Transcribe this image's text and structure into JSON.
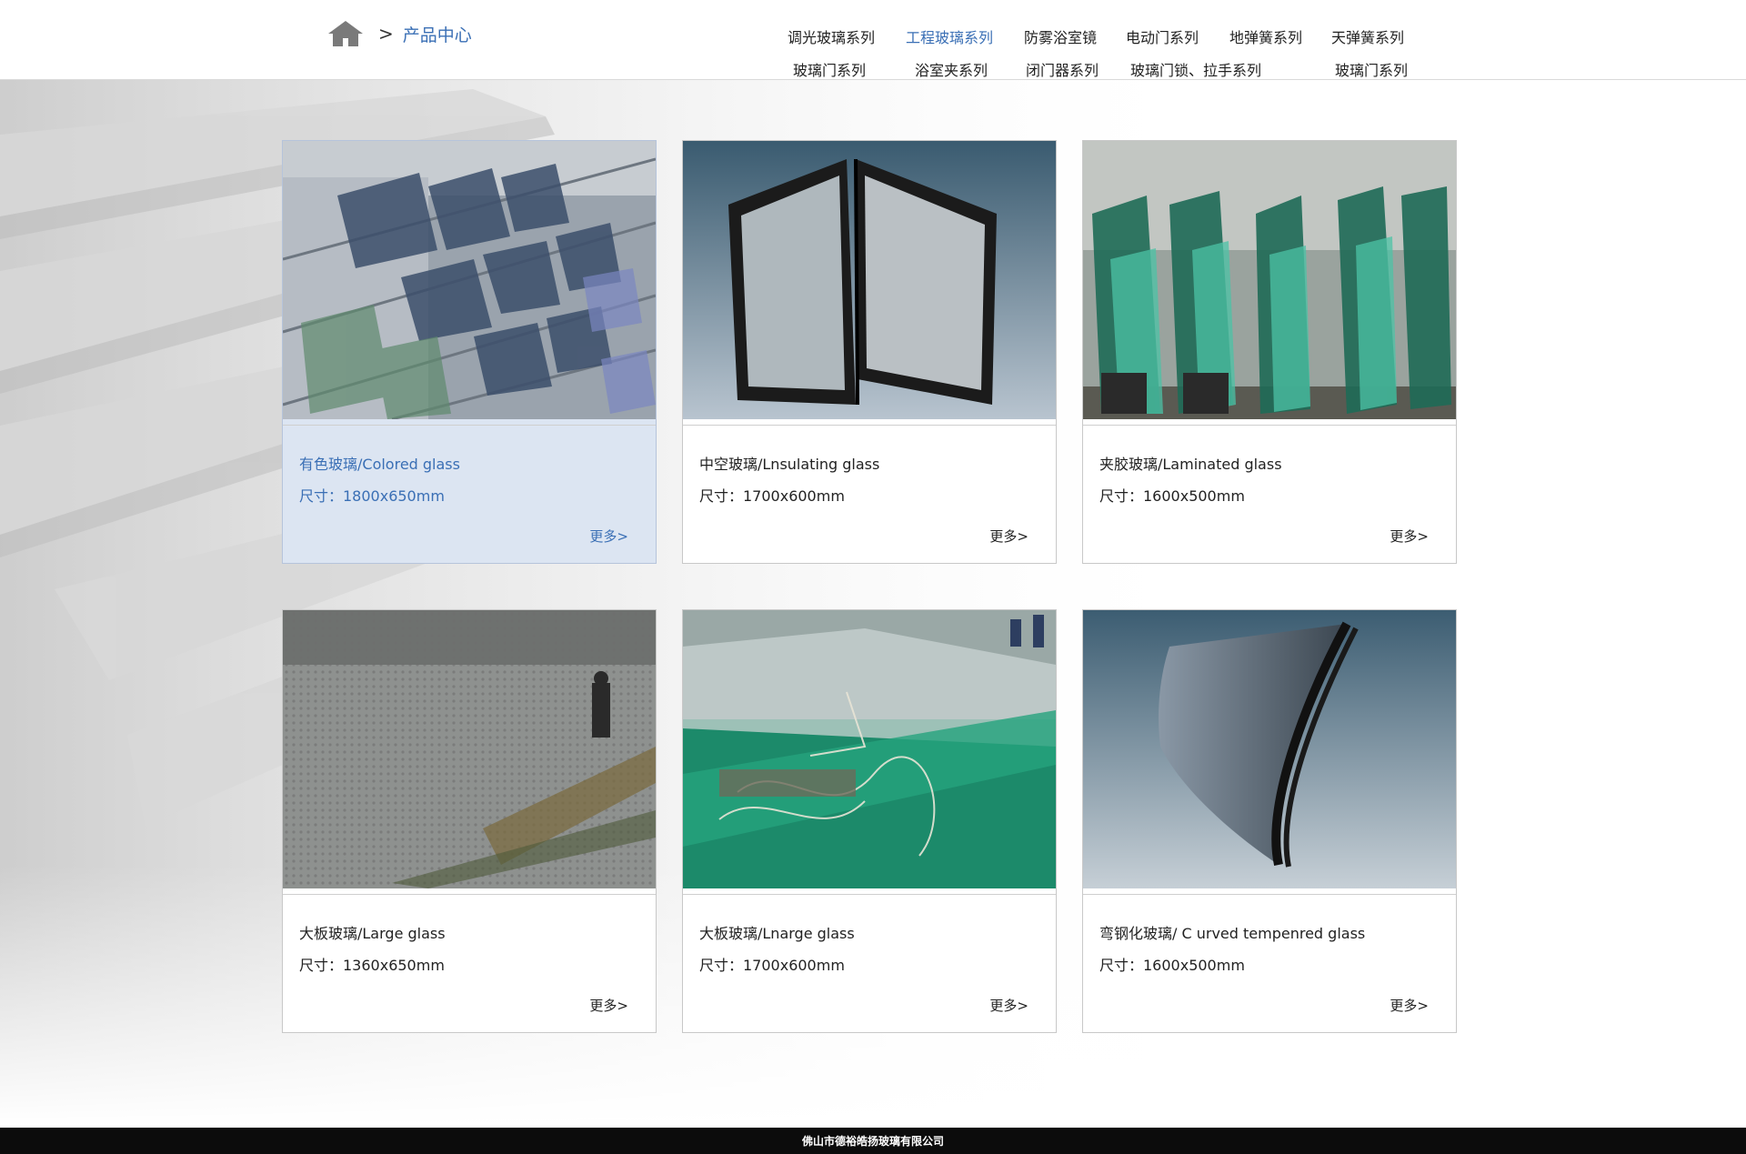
{
  "breadcrumb": {
    "home_icon": "home-icon",
    "separator": ">",
    "current": "产品中心"
  },
  "nav": {
    "active_index": 1,
    "items": [
      {
        "label": "调光玻璃系列"
      },
      {
        "label": "工程玻璃系列"
      },
      {
        "label": "防雾浴室镜"
      },
      {
        "label": "电动门系列"
      },
      {
        "label": "地弹簧系列"
      },
      {
        "label": "天弹簧系列"
      },
      {
        "label": "玻璃门系列"
      },
      {
        "label": "浴室夹系列"
      },
      {
        "label": "闭门器系列"
      },
      {
        "label": "玻璃门锁、拉手系列"
      },
      {
        "label": "玻璃门系列"
      }
    ]
  },
  "products": [
    {
      "name": "有色玻璃/Colored glass",
      "size": "尺寸：1800x650mm",
      "more": "更多>",
      "image": "colored-glass-photo"
    },
    {
      "name": "中空玻璃/Lnsulating glass",
      "size": "尺寸：1700x600mm",
      "more": "更多>",
      "image": "insulating-glass-photo"
    },
    {
      "name": "夹胶玻璃/Laminated glass",
      "size": "尺寸：1600x500mm",
      "more": "更多>",
      "image": "laminated-glass-photo"
    },
    {
      "name": "大板玻璃/Large glass",
      "size": "尺寸：1360x650mm",
      "more": "更多>",
      "image": "large-glass-photo"
    },
    {
      "name": "大板玻璃/Lnarge glass",
      "size": "尺寸：1700x600mm",
      "more": "更多>",
      "image": "large-glass-production-photo"
    },
    {
      "name": "弯钢化玻璃/ C urved tempenred glass",
      "size": "尺寸：1600x500mm",
      "more": "更多>",
      "image": "curved-glass-photo"
    }
  ],
  "footer": {
    "company": "佛山市德裕皓扬玻璃有限公司"
  },
  "colors": {
    "accent": "#3a6fb5",
    "highlight_card": "#dce5f2",
    "footer_bg": "#0c0c0c"
  }
}
